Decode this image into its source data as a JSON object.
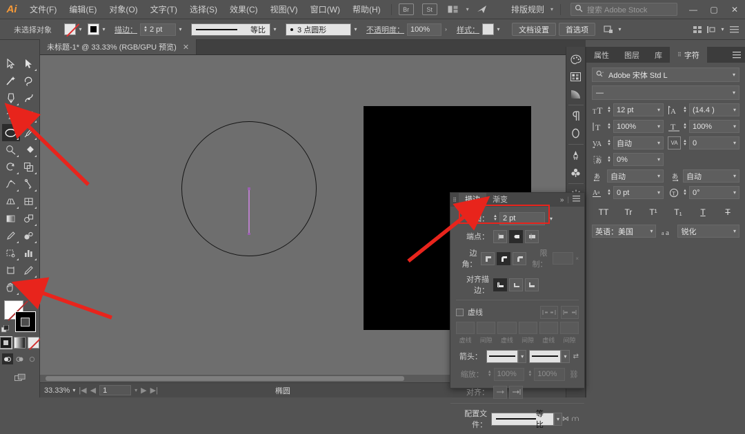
{
  "app": {
    "name": "Adobe Illustrator",
    "logo": "Ai"
  },
  "menubar": {
    "items": [
      "文件(F)",
      "编辑(E)",
      "对象(O)",
      "文字(T)",
      "选择(S)",
      "效果(C)",
      "视图(V)",
      "窗口(W)",
      "帮助(H)"
    ],
    "icons": [
      "br-icon",
      "stock-icon",
      "arrange-documents-icon",
      "chevron-down-icon",
      "sync-icon"
    ],
    "br_label": "Br",
    "st_label": "St",
    "workspace_label": "排版规则",
    "search_placeholder": "搜索 Adobe Stock",
    "search_icon": "search-icon",
    "window_minimize": "—",
    "window_maximize": "▢",
    "window_close": "✕"
  },
  "optionsbar": {
    "selection_status": "未选择对象",
    "fill_swatch": "none",
    "stroke_swatch": "black",
    "stroke_label": "描边：",
    "stroke_weight": "2 pt",
    "profile_label": "等比",
    "brush_label": "3 点圆形",
    "opacity_label": "不透明度：",
    "opacity_value": "100%",
    "style_label": "样式：",
    "doc_setup_button": "文档设置",
    "preferences_button": "首选项",
    "align_icon": "align-icon",
    "distribute_icon": "distribute-icon",
    "transform_icon": "transform-icon",
    "menu_icon": "panel-menu-icon"
  },
  "document": {
    "tab_title": "未标题-1* @ 33.33% (RGB/GPU 预览)",
    "close_icon": "close-icon"
  },
  "toolbar": {
    "tools": [
      {
        "name": "selection-tool",
        "glyph": "selection"
      },
      {
        "name": "direct-selection-tool",
        "glyph": "direct-selection"
      },
      {
        "name": "magic-wand-tool",
        "glyph": "magic-wand"
      },
      {
        "name": "lasso-tool",
        "glyph": "lasso"
      },
      {
        "name": "pen-tool",
        "glyph": "pen"
      },
      {
        "name": "curvature-tool",
        "glyph": "curvature"
      },
      {
        "name": "type-tool",
        "glyph": "type"
      },
      {
        "name": "line-segment-tool",
        "glyph": "line"
      },
      {
        "name": "ellipse-tool",
        "glyph": "ellipse",
        "active": true
      },
      {
        "name": "paintbrush-tool",
        "glyph": "paintbrush"
      },
      {
        "name": "shaper-tool",
        "glyph": "shaper"
      },
      {
        "name": "shape-builder-tool",
        "glyph": "shape-builder"
      },
      {
        "name": "rotate-tool",
        "glyph": "rotate"
      },
      {
        "name": "free-transform-tool",
        "glyph": "free-transform"
      },
      {
        "name": "width-tool",
        "glyph": "width"
      },
      {
        "name": "puppet-warp-tool",
        "glyph": "puppet-warp"
      },
      {
        "name": "perspective-grid-tool",
        "glyph": "perspective"
      },
      {
        "name": "mesh-tool",
        "glyph": "mesh"
      },
      {
        "name": "gradient-tool",
        "glyph": "gradient"
      },
      {
        "name": "blend-tool",
        "glyph": "blend"
      },
      {
        "name": "eyedropper-tool",
        "glyph": "eyedropper"
      },
      {
        "name": "symbol-sprayer-tool",
        "glyph": "symbol-sprayer"
      },
      {
        "name": "column-graph-tool",
        "glyph": "graph"
      },
      {
        "name": "artboard-tool",
        "glyph": "artboard"
      },
      {
        "name": "slice-tool",
        "glyph": "slice"
      },
      {
        "name": "hand-tool",
        "glyph": "hand"
      },
      {
        "name": "zoom-tool",
        "glyph": "zoom"
      }
    ],
    "fill_state": "none",
    "stroke_state": "black",
    "swap_icon": "swap-fill-stroke-icon",
    "default_icon": "default-fill-stroke-icon",
    "color_modes": [
      "color-swatch",
      "gradient-swatch",
      "none-swatch"
    ],
    "screen_modes": [
      "draw-normal",
      "draw-behind",
      "draw-inside"
    ],
    "screen_mode_icon": "change-screen-mode-icon"
  },
  "canvas": {
    "shapes": [
      {
        "name": "ellipse-shape",
        "type": "circle",
        "stroke": "#141414",
        "fill": "none"
      },
      {
        "name": "vertical-line-shape",
        "type": "line",
        "color": "#b981c9"
      },
      {
        "name": "black-rectangle",
        "type": "rect",
        "fill": "#000000"
      }
    ]
  },
  "statusbar": {
    "zoom": "33.33%",
    "page": "1",
    "current_tool": "椭圆",
    "first_icon": "first-page-icon",
    "prev_icon": "prev-page-icon",
    "next_icon": "next-page-icon",
    "last_icon": "last-page-icon"
  },
  "dock_rail": {
    "icons": [
      "color-icon",
      "swatches-icon",
      "gradient-icon",
      "paragraph-icon",
      "glyphs-icon",
      "brushes-icon",
      "symbols-icon",
      "appearance-icon",
      "transparency-icon",
      "pathfinder-icon",
      "artboards-icon",
      "layers-list-icon",
      "image-trace-icon",
      "transform-panel-icon",
      "align-panel-icon",
      "document-info-icon"
    ]
  },
  "character_panel": {
    "tabs": [
      "属性",
      "图层",
      "库",
      "字符"
    ],
    "active_tab": "字符",
    "menu_icon": "panel-menu-icon",
    "font_family": "Adobe 宋体 Std L",
    "font_family_icon": "search-font-icon",
    "font_style": "—",
    "font_size": "12 pt",
    "font_size_icon": "font-size-icon",
    "leading": "(14.4 )",
    "leading_icon": "leading-icon",
    "vertical_scale": "100%",
    "vertical_scale_icon": "vertical-scale-icon",
    "horizontal_scale": "100%",
    "horizontal_scale_icon": "horizontal-scale-icon",
    "kerning": "自动",
    "kerning_icon": "kerning-icon",
    "tracking": "0",
    "tracking_icon": "tracking-icon",
    "tsume": "0%",
    "tsume_icon": "tsume-icon",
    "aki_before": "自动",
    "aki_before_icon": "aki-before-icon",
    "aki_after": "自动",
    "aki_after_icon": "aki-after-icon",
    "baseline_shift": "0 pt",
    "baseline_icon": "baseline-shift-icon",
    "rotation": "0°",
    "rotation_icon": "character-rotation-icon",
    "style_buttons": [
      "TT",
      "Tr",
      "T¹",
      "T₁",
      "T",
      "T"
    ],
    "style_button_names": [
      "all-caps-button",
      "small-caps-button",
      "superscript-button",
      "subscript-button",
      "underline-button",
      "strikethrough-button"
    ],
    "language": "英语：美国",
    "anti_alias": "锐化",
    "anti_alias_icon": "anti-alias-icon"
  },
  "stroke_panel": {
    "tabs": [
      "描边",
      "渐变"
    ],
    "active_tab": "描边",
    "collapse_icon": "collapse-icon",
    "menu_icon": "panel-menu-icon",
    "weight_label": "粗细：",
    "weight_value": "2 pt",
    "cap_label": "端点：",
    "cap_buttons": [
      "butt-cap",
      "round-cap",
      "projecting-cap"
    ],
    "cap_selected": 1,
    "corner_label": "边角：",
    "corner_buttons": [
      "miter-join",
      "round-join",
      "bevel-join"
    ],
    "corner_selected": 1,
    "limit_label": "限制：",
    "limit_value": "",
    "align_label": "对齐描边：",
    "align_buttons": [
      "align-center-stroke",
      "align-inside-stroke",
      "align-outside-stroke"
    ],
    "align_selected": 0,
    "dashed_label": "虚线",
    "dashed_checked": false,
    "dash_end_buttons": [
      "preserve-dash-icon",
      "align-dash-icon"
    ],
    "dash_fields": [
      "",
      "",
      "",
      "",
      "",
      ""
    ],
    "dash_labels": [
      "虚线",
      "间隙",
      "虚线",
      "间隙",
      "虚线",
      "间隙"
    ],
    "arrowheads_label": "箭头：",
    "arrow_start": "none-arrow",
    "arrow_end": "none-arrow",
    "swap_arrows_icon": "swap-arrowheads-icon",
    "scale_label": "缩放：",
    "scale_start": "100%",
    "scale_end": "100%",
    "link_icon": "link-scale-icon",
    "extend_label": "对齐：",
    "extend_buttons": [
      "extend-arrow-beyond-end",
      "place-arrow-at-end"
    ],
    "profile_label": "配置文件：",
    "profile_value": "等比",
    "flip_h_icon": "flip-horizontal-icon",
    "flip_v_icon": "flip-vertical-icon"
  },
  "annotations": {
    "highlight_color": "#e8241c",
    "arrows": [
      {
        "name": "arrow-to-ellipse-tool"
      },
      {
        "name": "arrow-to-stroke-swatch"
      },
      {
        "name": "arrow-to-stroke-weight"
      }
    ],
    "highlight_box": {
      "name": "stroke-weight-highlight"
    }
  }
}
